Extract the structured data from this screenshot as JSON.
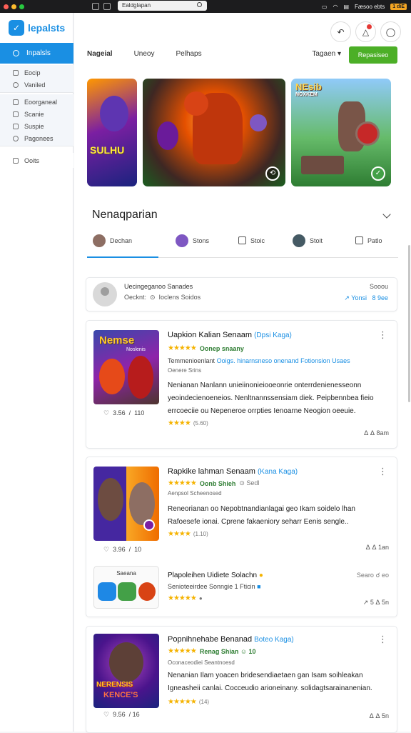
{
  "menubar": {
    "search_text": "Ealdglapan",
    "right_text": "Fæsoo ebts",
    "badge": "1 diE"
  },
  "app": {
    "logo_text": "lepalsts"
  },
  "sidebar": {
    "active_label": "Inpalsls",
    "group1": [
      "Eocip",
      "Vaniled"
    ],
    "group2": [
      "Eoorganeal",
      "Scanie",
      "Suspie",
      "Pagonees"
    ],
    "group3": [
      "Ooits"
    ]
  },
  "topbar": {
    "tabs": [
      "Nageial",
      "Uneoy",
      "Pelhaps"
    ],
    "region": "Tagaen ▾",
    "primary_button": "Repasiseo"
  },
  "banners": [
    {
      "title": "SULHU",
      "sub": ""
    },
    {
      "title": "",
      "sub": ""
    },
    {
      "title": "NEsib",
      "sub": "NOXKEM"
    }
  ],
  "section": {
    "title": "Nenaqparian",
    "subtabs": [
      "Dechan",
      "Stons",
      "Stoic",
      "Stoit",
      "Patlo"
    ]
  },
  "search_card": {
    "line1": "Uecingeganoo Sanades",
    "line2": "Oecknt:  ⊙  Ioclens Soidos",
    "right1": "Sooou",
    "right2": "↗ Yonsi   8 9ee"
  },
  "games": [
    {
      "thumb_title": "Nemse",
      "thumb_sub": "Noslenis",
      "meta": "♡  3.56  /  110",
      "title": "Uapkion Kalian Senaam",
      "tag": "(Dpsi Kaga)",
      "stars": "★★★★★",
      "rating_text": "Oonep snaany",
      "line3_a": "Temmenioenlant",
      "line3_b": "Ooigs. hinarnsneso onenand Fotionsion Usaes",
      "line4": "Oenere Srins",
      "desc": "Nenianan Nanlann unieiinonieiooeonrie onterrdenienesseonn yeoindecienoeneios. Nenltnannssensiam diek. Peipbennbea fieio errcoeciie ou Nepeneroe orrpties Ienoarne Neogion oeeuie.",
      "mini_stars": "★★★★",
      "mini_count": "(5.60)",
      "actions": "ᐃ ᐃ 8am"
    },
    {
      "thumb_title": "",
      "thumb_sub": "",
      "meta": "♡  3.96  /  10",
      "title": "Rapkike lahman Senaam",
      "tag": "(Kana Kaga)",
      "stars": "★★★★★",
      "rating_text": "Oonb Shieh",
      "line3_a": "Aenpsol Scheenosed",
      "line3_b": "",
      "line4": "",
      "desc": "Reneorianan oo Nepobtnandianlagai geo Ikam soidelo lhan Rafoesefe ionai. Cprene fakaeniory seharr Eenis sengle..",
      "mini_stars": "★★★★",
      "mini_count": "(1.10)",
      "actions": "ᐃ ᐃ 1an"
    },
    {
      "thumb_title": "Saeana",
      "thumb_sub": "",
      "meta": "",
      "title": "Plapoleihen Uidiete Solachn",
      "tag": "",
      "stars": "★★★★★",
      "rating_text": "",
      "line3_a": "Senioteeirdee Sonngie 1 Fticin",
      "line3_b": "",
      "line4": "",
      "desc": "",
      "right_top": "Searo ☌ eo",
      "actions": "↗ 5 ᐃ 5n"
    },
    {
      "thumb_title": "NERENSIS",
      "thumb_sub": "KENCE'S",
      "meta": "♡  9.56  / 16",
      "title": "Popnihnehabe Benanad",
      "tag": "Boteo Kaga)",
      "stars": "★★★★★",
      "rating_text": "Renag Shian ☺ 10",
      "line3_a": "Oconaceodiei Seantnoesd",
      "line3_b": "",
      "line4": "",
      "desc": "Nenanian Ilam yoacen bridesendiaetaen gan Isam soihleakan Igneasheii canlai. Cocceudio arioneinany. solidagtsarainanenian.",
      "mini_stars": "★★★★★",
      "mini_count": "(14)",
      "actions": "ᐃ ᐃ 5n"
    }
  ],
  "colors": {
    "accent": "#1a8fe3",
    "primary_green": "#4caf27",
    "star": "#f5b301"
  }
}
